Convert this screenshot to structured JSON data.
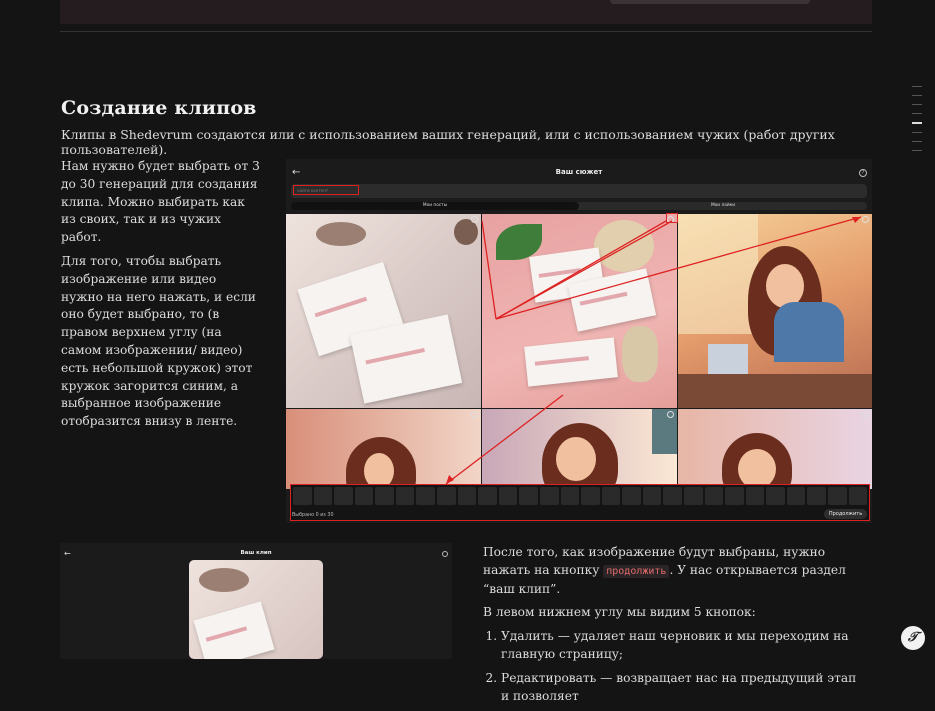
{
  "section": {
    "title": "Создание клипов",
    "intro": "Клипы в Shedevrum создаются или с использованием ваших генераций, или с использованием чужих (работ других пользователей)."
  },
  "left_text": {
    "p1": "Нам нужно будет выбрать от 3 до 30 генераций для создания клипа. Можно выбирать как из своих, так и из чужих работ.",
    "p2": "Для того, чтобы выбрать изображение или видео нужно на него нажать, и если оно будет выбрано, то (в правом верхнем углу (на самом изображении/ видео) есть небольшой кружок) этот кружок загорится синим, а выбранное изображение отобразится внизу в ленте."
  },
  "screenshot1": {
    "back_icon": "←",
    "title": "Ваш сюжет",
    "help_icon": "?",
    "search_placeholder": "найти контент",
    "tabs": [
      "Мои посты",
      "Мои лайки"
    ],
    "selected_count": "Выбрано 0 из 30",
    "continue_label": "Продолжить"
  },
  "screenshot2": {
    "back_icon": "←",
    "title": "Ваш клип"
  },
  "right_text": {
    "p1_before": "После того, как изображение будут выбраны, нужно нажать на кнопку",
    "p1_code": "продолжить",
    "p1_after": ". У нас открывается раздел “ваш клип”.",
    "p2": "В левом нижнем углу мы видим 5 кнопок:",
    "items": [
      "Удалить — удаляет наш черновик и мы переходим на главную страницу;",
      "Редактировать — возвращает нас на предыдущий этап и позволяет"
    ]
  },
  "fab": {
    "icon": "𝒯"
  },
  "colors": {
    "accent_red": "#dd2222",
    "code": "#e36b6b",
    "bg": "#141414"
  }
}
